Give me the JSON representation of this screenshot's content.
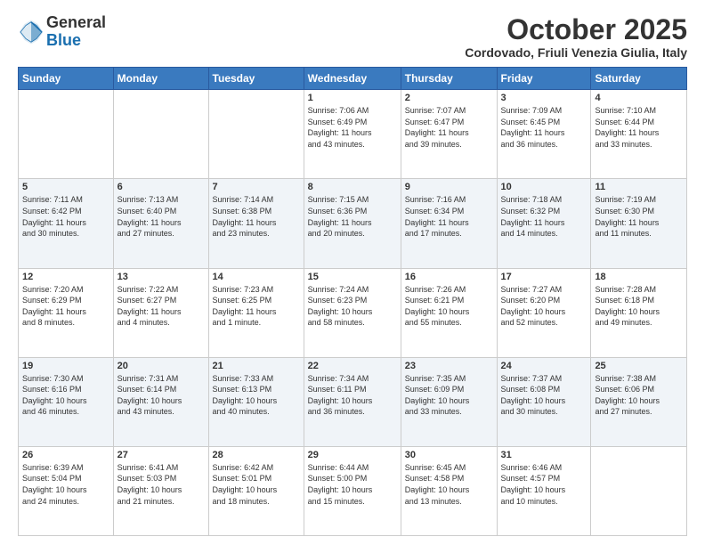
{
  "logo": {
    "general": "General",
    "blue": "Blue"
  },
  "header": {
    "month": "October 2025",
    "location": "Cordovado, Friuli Venezia Giulia, Italy"
  },
  "days_of_week": [
    "Sunday",
    "Monday",
    "Tuesday",
    "Wednesday",
    "Thursday",
    "Friday",
    "Saturday"
  ],
  "weeks": [
    [
      {
        "day": "",
        "info": ""
      },
      {
        "day": "",
        "info": ""
      },
      {
        "day": "",
        "info": ""
      },
      {
        "day": "1",
        "info": "Sunrise: 7:06 AM\nSunset: 6:49 PM\nDaylight: 11 hours\nand 43 minutes."
      },
      {
        "day": "2",
        "info": "Sunrise: 7:07 AM\nSunset: 6:47 PM\nDaylight: 11 hours\nand 39 minutes."
      },
      {
        "day": "3",
        "info": "Sunrise: 7:09 AM\nSunset: 6:45 PM\nDaylight: 11 hours\nand 36 minutes."
      },
      {
        "day": "4",
        "info": "Sunrise: 7:10 AM\nSunset: 6:44 PM\nDaylight: 11 hours\nand 33 minutes."
      }
    ],
    [
      {
        "day": "5",
        "info": "Sunrise: 7:11 AM\nSunset: 6:42 PM\nDaylight: 11 hours\nand 30 minutes."
      },
      {
        "day": "6",
        "info": "Sunrise: 7:13 AM\nSunset: 6:40 PM\nDaylight: 11 hours\nand 27 minutes."
      },
      {
        "day": "7",
        "info": "Sunrise: 7:14 AM\nSunset: 6:38 PM\nDaylight: 11 hours\nand 23 minutes."
      },
      {
        "day": "8",
        "info": "Sunrise: 7:15 AM\nSunset: 6:36 PM\nDaylight: 11 hours\nand 20 minutes."
      },
      {
        "day": "9",
        "info": "Sunrise: 7:16 AM\nSunset: 6:34 PM\nDaylight: 11 hours\nand 17 minutes."
      },
      {
        "day": "10",
        "info": "Sunrise: 7:18 AM\nSunset: 6:32 PM\nDaylight: 11 hours\nand 14 minutes."
      },
      {
        "day": "11",
        "info": "Sunrise: 7:19 AM\nSunset: 6:30 PM\nDaylight: 11 hours\nand 11 minutes."
      }
    ],
    [
      {
        "day": "12",
        "info": "Sunrise: 7:20 AM\nSunset: 6:29 PM\nDaylight: 11 hours\nand 8 minutes."
      },
      {
        "day": "13",
        "info": "Sunrise: 7:22 AM\nSunset: 6:27 PM\nDaylight: 11 hours\nand 4 minutes."
      },
      {
        "day": "14",
        "info": "Sunrise: 7:23 AM\nSunset: 6:25 PM\nDaylight: 11 hours\nand 1 minute."
      },
      {
        "day": "15",
        "info": "Sunrise: 7:24 AM\nSunset: 6:23 PM\nDaylight: 10 hours\nand 58 minutes."
      },
      {
        "day": "16",
        "info": "Sunrise: 7:26 AM\nSunset: 6:21 PM\nDaylight: 10 hours\nand 55 minutes."
      },
      {
        "day": "17",
        "info": "Sunrise: 7:27 AM\nSunset: 6:20 PM\nDaylight: 10 hours\nand 52 minutes."
      },
      {
        "day": "18",
        "info": "Sunrise: 7:28 AM\nSunset: 6:18 PM\nDaylight: 10 hours\nand 49 minutes."
      }
    ],
    [
      {
        "day": "19",
        "info": "Sunrise: 7:30 AM\nSunset: 6:16 PM\nDaylight: 10 hours\nand 46 minutes."
      },
      {
        "day": "20",
        "info": "Sunrise: 7:31 AM\nSunset: 6:14 PM\nDaylight: 10 hours\nand 43 minutes."
      },
      {
        "day": "21",
        "info": "Sunrise: 7:33 AM\nSunset: 6:13 PM\nDaylight: 10 hours\nand 40 minutes."
      },
      {
        "day": "22",
        "info": "Sunrise: 7:34 AM\nSunset: 6:11 PM\nDaylight: 10 hours\nand 36 minutes."
      },
      {
        "day": "23",
        "info": "Sunrise: 7:35 AM\nSunset: 6:09 PM\nDaylight: 10 hours\nand 33 minutes."
      },
      {
        "day": "24",
        "info": "Sunrise: 7:37 AM\nSunset: 6:08 PM\nDaylight: 10 hours\nand 30 minutes."
      },
      {
        "day": "25",
        "info": "Sunrise: 7:38 AM\nSunset: 6:06 PM\nDaylight: 10 hours\nand 27 minutes."
      }
    ],
    [
      {
        "day": "26",
        "info": "Sunrise: 6:39 AM\nSunset: 5:04 PM\nDaylight: 10 hours\nand 24 minutes."
      },
      {
        "day": "27",
        "info": "Sunrise: 6:41 AM\nSunset: 5:03 PM\nDaylight: 10 hours\nand 21 minutes."
      },
      {
        "day": "28",
        "info": "Sunrise: 6:42 AM\nSunset: 5:01 PM\nDaylight: 10 hours\nand 18 minutes."
      },
      {
        "day": "29",
        "info": "Sunrise: 6:44 AM\nSunset: 5:00 PM\nDaylight: 10 hours\nand 15 minutes."
      },
      {
        "day": "30",
        "info": "Sunrise: 6:45 AM\nSunset: 4:58 PM\nDaylight: 10 hours\nand 13 minutes."
      },
      {
        "day": "31",
        "info": "Sunrise: 6:46 AM\nSunset: 4:57 PM\nDaylight: 10 hours\nand 10 minutes."
      },
      {
        "day": "",
        "info": ""
      }
    ]
  ]
}
